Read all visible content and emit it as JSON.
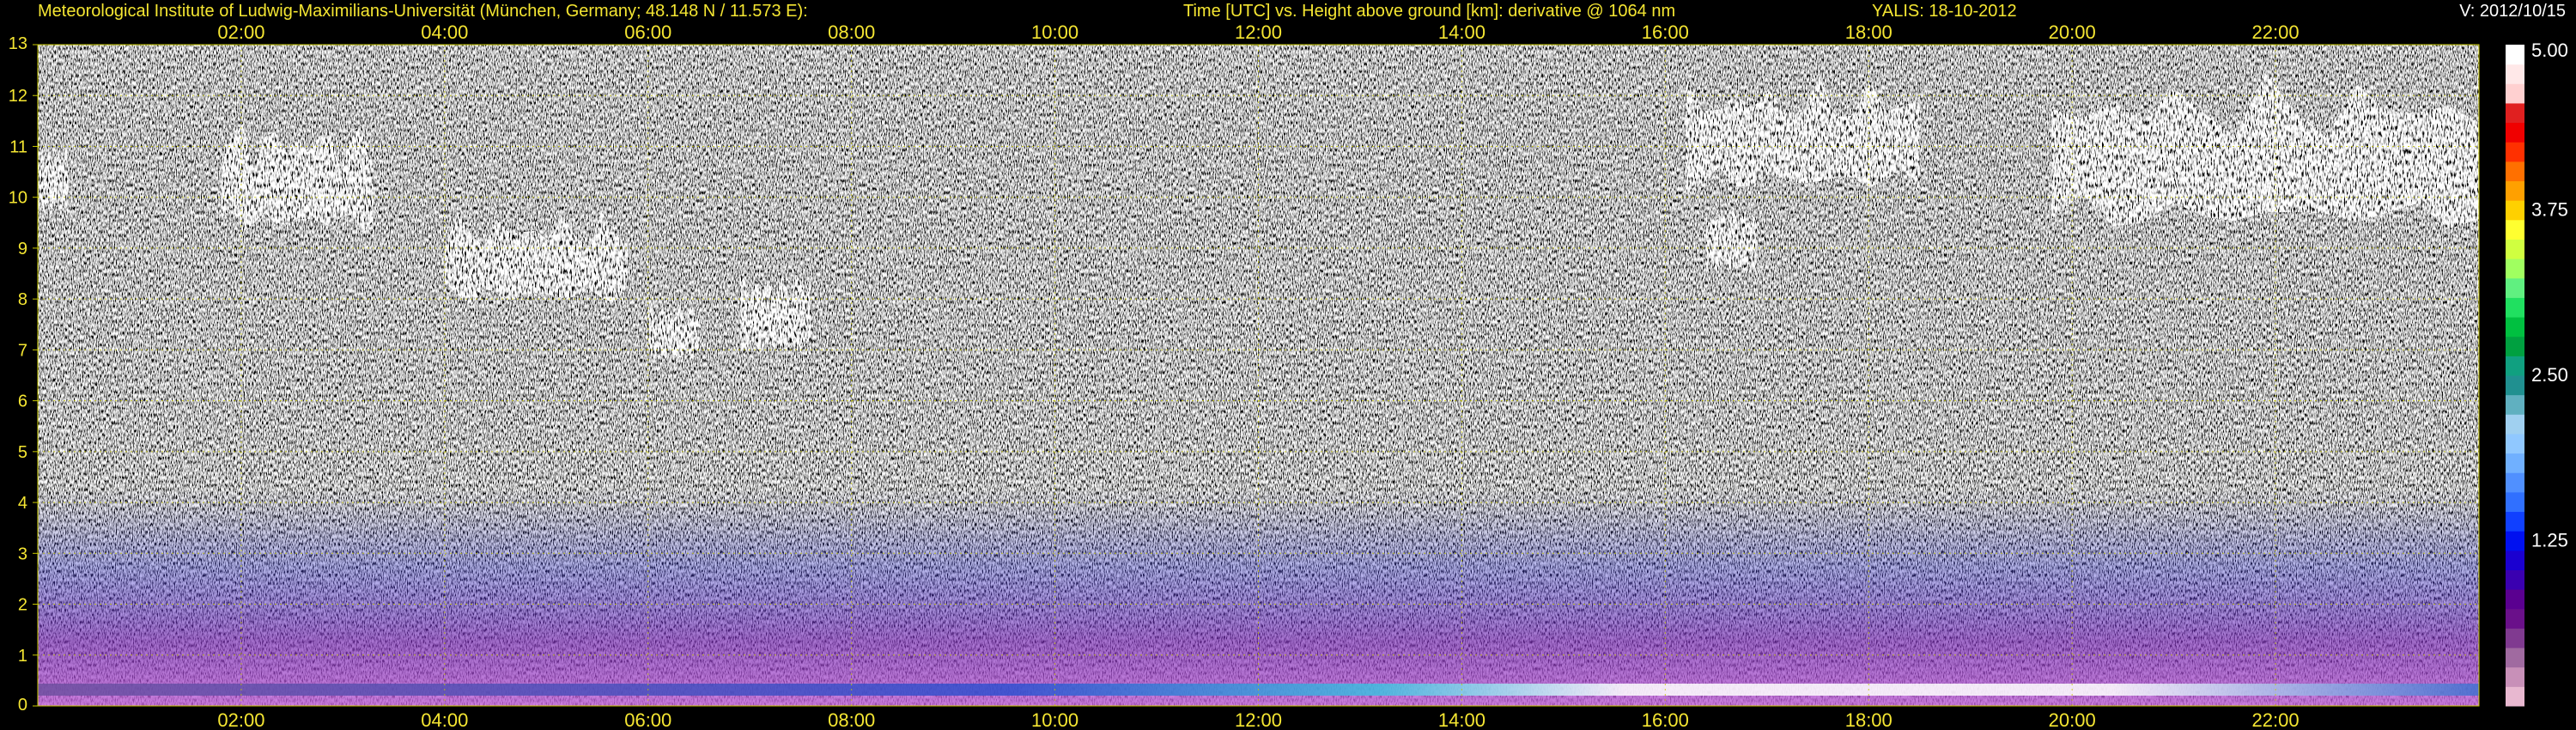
{
  "header": {
    "institute": "Meteorological Institute of Ludwig-Maximilians-Universität (München, Germany; 48.148 N / 11.573 E):",
    "axis_description": "Time [UTC] vs. Height above ground [km]: derivative @ 1064 nm",
    "station_date": "YALIS: 18-10-2012",
    "version": "V: 2012/10/15"
  },
  "colors": {
    "text": "#f5e632",
    "grid": "#c8c800",
    "background": "#000000",
    "version_text": "#ffffff"
  },
  "chart_data": {
    "type": "heatmap",
    "xlabel": "Time [UTC]",
    "ylabel": "Height above ground [km]",
    "x_range_hours": [
      0,
      24
    ],
    "xlim": [
      "00:00",
      "24:00"
    ],
    "ylim": [
      0,
      13
    ],
    "grid": true,
    "x_ticks": [
      "02:00",
      "04:00",
      "06:00",
      "08:00",
      "10:00",
      "12:00",
      "14:00",
      "16:00",
      "18:00",
      "20:00",
      "22:00"
    ],
    "y_ticks": [
      "0",
      "1",
      "2",
      "3",
      "4",
      "5",
      "6",
      "7",
      "8",
      "9",
      "10",
      "11",
      "12",
      "13"
    ],
    "colorbar": {
      "ticks": [
        "1.25",
        "2.50",
        "3.75",
        "5.00"
      ],
      "range": [
        0,
        5
      ]
    },
    "features": [
      {
        "name": "cloud",
        "t_start": 0.0,
        "t_end": 0.3,
        "h_low": 9.6,
        "h_high": 11.0
      },
      {
        "name": "cloud",
        "t_start": 1.8,
        "t_end": 3.3,
        "h_low": 9.2,
        "h_high": 11.4
      },
      {
        "name": "cloud",
        "t_start": 4.0,
        "t_end": 5.8,
        "h_low": 7.8,
        "h_high": 9.6
      },
      {
        "name": "cloud",
        "t_start": 6.0,
        "t_end": 6.5,
        "h_low": 6.7,
        "h_high": 7.9
      },
      {
        "name": "cloud",
        "t_start": 6.9,
        "t_end": 7.6,
        "h_low": 6.8,
        "h_high": 8.5
      },
      {
        "name": "cloud",
        "t_start": 16.2,
        "t_end": 18.5,
        "h_low": 10.0,
        "h_high": 12.2
      },
      {
        "name": "cloud",
        "t_start": 16.4,
        "t_end": 16.9,
        "h_low": 8.4,
        "h_high": 9.8
      },
      {
        "name": "cloud",
        "t_start": 19.8,
        "t_end": 24.0,
        "h_low": 9.2,
        "h_high": 12.2
      }
    ]
  }
}
